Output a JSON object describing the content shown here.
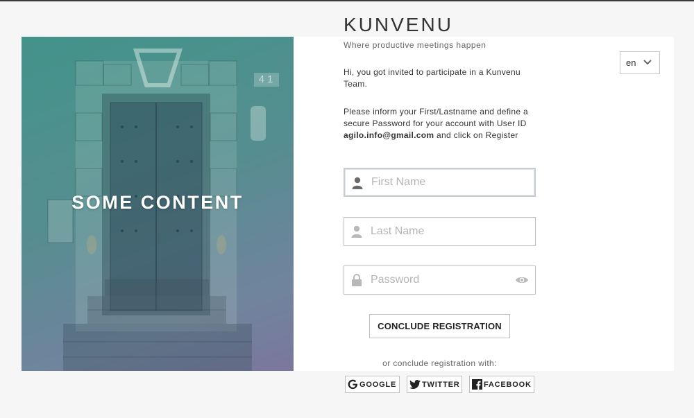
{
  "brand": {
    "name": "KUNVENU",
    "tagline": "Where productive meetings happen"
  },
  "hero": {
    "text": "SOME CONTENT",
    "door_number": "41"
  },
  "language": {
    "selected": "en"
  },
  "intro": {
    "invite_text": "Hi, you got invited to participate in a Kunvenu Team.",
    "instruction_before": "Please inform your First/Lastname and define a secure Password for your account with User ID ",
    "user_id": "agilo.info@gmail.com",
    "instruction_after": " and click on Register"
  },
  "form": {
    "first_name_placeholder": "First Name",
    "last_name_placeholder": "Last Name",
    "password_placeholder": "Password",
    "submit_label": "CONCLUDE REGISTRATION"
  },
  "social": {
    "prompt": "or conclude registration with:",
    "google_label": "GOOGLE",
    "twitter_label": "TWITTER",
    "facebook_label": "FACEBOOK"
  },
  "icons": [
    "user-icon",
    "lock-icon",
    "eye-icon",
    "chevron-down-icon",
    "google-icon",
    "twitter-icon",
    "facebook-icon"
  ]
}
